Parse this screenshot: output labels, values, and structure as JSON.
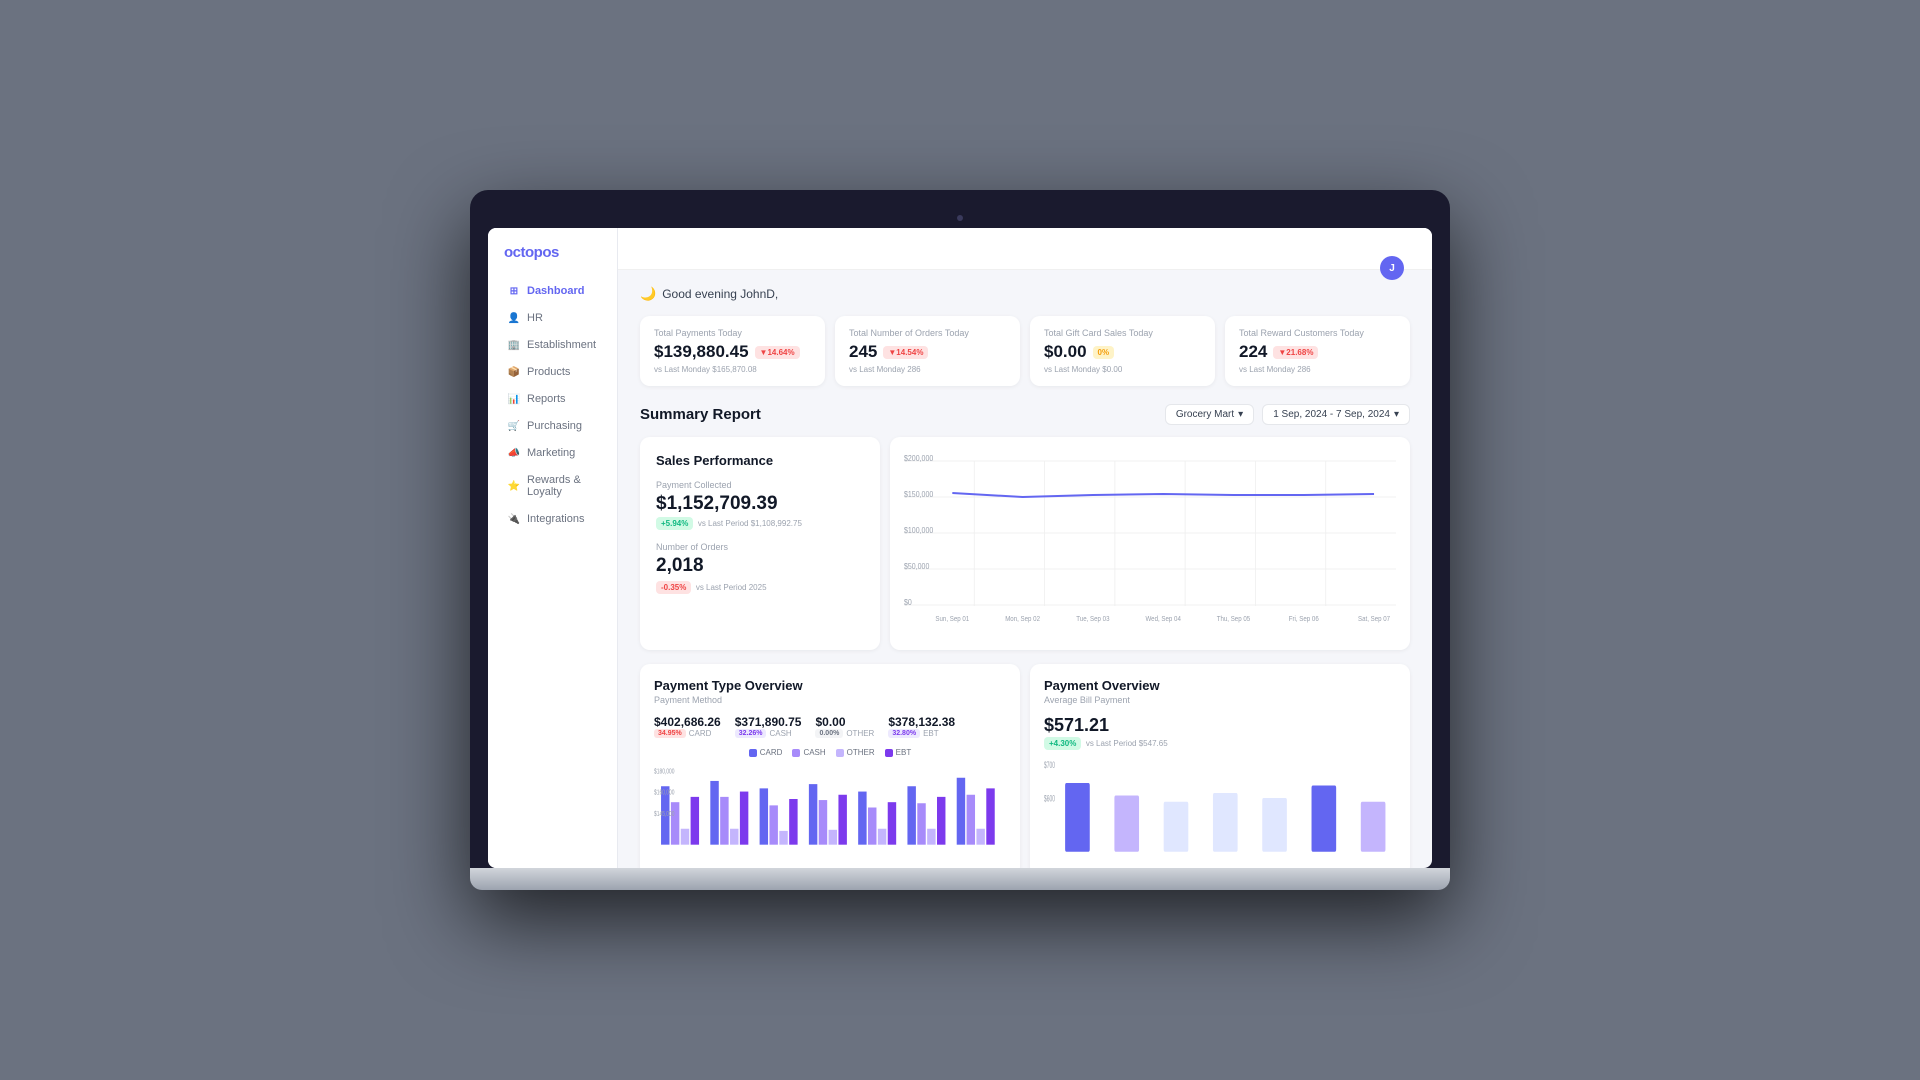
{
  "app": {
    "name": "octopos",
    "user_initial": "J"
  },
  "greeting": {
    "icon": "🌙",
    "text": "Good evening JohnD,"
  },
  "nav": {
    "items": [
      {
        "id": "dashboard",
        "label": "Dashboard",
        "icon": "⊞",
        "active": true
      },
      {
        "id": "hr",
        "label": "HR",
        "icon": "👤",
        "active": false
      },
      {
        "id": "establishment",
        "label": "Establishment",
        "icon": "🏢",
        "active": false
      },
      {
        "id": "products",
        "label": "Products",
        "icon": "📦",
        "active": false
      },
      {
        "id": "reports",
        "label": "Reports",
        "icon": "📊",
        "active": false
      },
      {
        "id": "purchasing",
        "label": "Purchasing",
        "icon": "🛒",
        "active": false
      },
      {
        "id": "marketing",
        "label": "Marketing",
        "icon": "📣",
        "active": false
      },
      {
        "id": "rewards",
        "label": "Rewards & Loyalty",
        "icon": "⭐",
        "active": false
      },
      {
        "id": "integrations",
        "label": "Integrations",
        "icon": "🔌",
        "active": false
      }
    ]
  },
  "stat_cards": [
    {
      "label": "Total Payments Today",
      "value": "$139,880.45",
      "badge_type": "red",
      "badge_text": "▼14.64%",
      "sub": "vs Last Monday $165,870.08"
    },
    {
      "label": "Total Number of Orders Today",
      "value": "245",
      "badge_type": "red",
      "badge_text": "▼14.54%",
      "sub": "vs Last Monday 286"
    },
    {
      "label": "Total Gift Card Sales Today",
      "value": "$0.00",
      "badge_type": "yellow",
      "badge_text": "0%",
      "sub": "vs Last Monday $0.00"
    },
    {
      "label": "Total Reward Customers Today",
      "value": "224",
      "badge_type": "red",
      "badge_text": "▼21.68%",
      "sub": "vs Last Monday 286"
    }
  ],
  "summary": {
    "title": "Summary Report",
    "store_filter": "Grocery Mart",
    "date_range": "1 Sep, 2024 - 7 Sep, 2024"
  },
  "sales_performance": {
    "title": "Sales Performance",
    "payment_label": "Payment Collected",
    "payment_value": "$1,152,709.39",
    "payment_badge": "+5.94%",
    "payment_vs": "vs Last Period $1,108,992.75",
    "orders_label": "Number of Orders",
    "orders_value": "2,018",
    "orders_badge": "-0.35%",
    "orders_vs": "vs Last Period 2025"
  },
  "chart": {
    "y_labels": [
      "$200,000",
      "$150,000",
      "$100,000",
      "$50,000",
      "$0"
    ],
    "x_labels": [
      "Sun, Sep 01",
      "Mon, Sep 02",
      "Tue, Sep 03",
      "Wed, Sep 04",
      "Thu, Sep 05",
      "Fri, Sep 06",
      "Sat, Sep 07"
    ],
    "line_color": "#6366f1"
  },
  "payment_type": {
    "title": "Payment Type Overview",
    "sub": "Payment Method",
    "methods": [
      {
        "value": "$402,686.26",
        "label": "CARD",
        "badge": "34.95%",
        "badge_type": "red"
      },
      {
        "value": "$371,890.75",
        "label": "CASH",
        "badge": "32.26%",
        "badge_type": "purple"
      },
      {
        "value": "$0.00",
        "label": "OTHER",
        "badge": "0.00%",
        "badge_type": "gray"
      },
      {
        "value": "$378,132.38",
        "label": "EBT",
        "badge": "32.80%",
        "badge_type": "purple"
      }
    ],
    "legend": [
      {
        "label": "CARD",
        "color": "#6366f1"
      },
      {
        "label": "CASH",
        "color": "#a78bfa"
      },
      {
        "label": "OTHER",
        "color": "#c4b5fd"
      },
      {
        "label": "EBT",
        "color": "#7c3aed"
      }
    ]
  },
  "payment_overview": {
    "title": "Payment Overview",
    "sub": "Average Bill Payment",
    "value": "$571.21",
    "badge": "+4.30%",
    "vs": "vs Last Period $547.65"
  }
}
